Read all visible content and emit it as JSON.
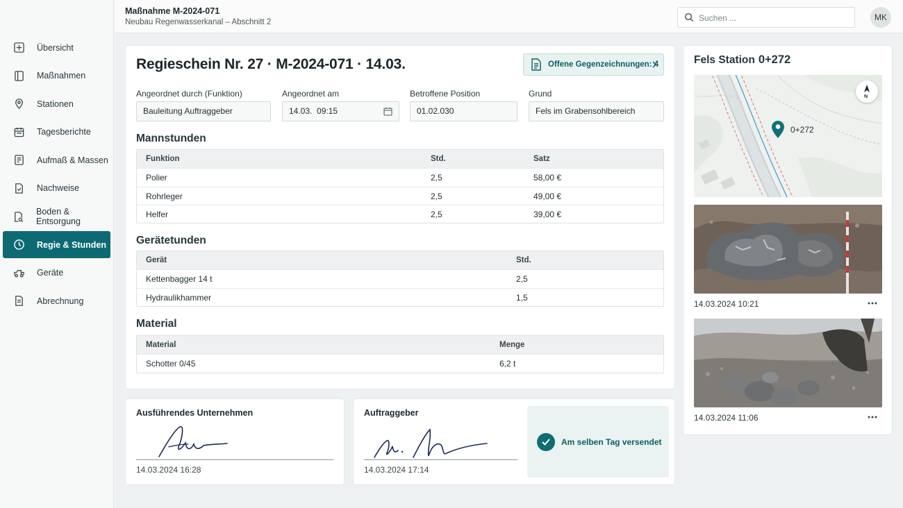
{
  "header": {
    "title": "Maßnahme M-2024-071",
    "subtitle": "Neubau Regenwasserkanal – Abschnitt 2",
    "search_placeholder": "Suchen ...",
    "avatar_initials": "MK"
  },
  "sidebar": {
    "items": [
      {
        "label": "Übersicht",
        "icon": "overview-icon"
      },
      {
        "label": "Maßnahmen",
        "icon": "measures-icon"
      },
      {
        "label": "Stationen",
        "icon": "location-pin-icon"
      },
      {
        "label": "Tagesberichte",
        "icon": "calendar-icon"
      },
      {
        "label": "Aufmaß & Massen",
        "icon": "checklist-icon"
      },
      {
        "label": "Nachweise",
        "icon": "document-check-icon"
      },
      {
        "label": "Boden & Entsorgung",
        "icon": "soil-search-icon"
      },
      {
        "label": "Regie & Stunden",
        "icon": "clock-icon",
        "active": true
      },
      {
        "label": "Geräte",
        "icon": "vehicle-icon"
      },
      {
        "label": "Abrechnung",
        "icon": "invoice-icon"
      }
    ]
  },
  "document": {
    "title": "Regieschein Nr. 27 · M-2024-071 · 14.03.",
    "pending_label": "Offene Gegenzeichnungen: 4",
    "fields": {
      "ordered_by_label": "Angeordnet durch (Funktion)",
      "ordered_by_value": "Bauleitung Auftraggeber",
      "ordered_at_label": "Angeordnet am",
      "ordered_at_value": "14.03.  09:15",
      "position_label": "Betroffene Position",
      "position_value": "01.02.030",
      "reason_label": "Grund",
      "reason_value": "Fels im Grabensohlbereich"
    },
    "labor": {
      "title": "Mannstunden",
      "headers": [
        "Funktion",
        "Std.",
        "Satz"
      ],
      "rows": [
        [
          "Polier",
          "2,5",
          "58,00 €"
        ],
        [
          "Rohrleger",
          "2,5",
          "49,00 €"
        ],
        [
          "Helfer",
          "2,5",
          "39,00 €"
        ]
      ]
    },
    "equipment": {
      "title": "Gerätetunden",
      "headers": [
        "Gerät",
        "Std."
      ],
      "rows": [
        [
          "Kettenbagger 14 t",
          "2,5"
        ],
        [
          "Hydraulikhammer",
          "1,5"
        ]
      ]
    },
    "material": {
      "title": "Material",
      "headers": [
        "Material",
        "Menge"
      ],
      "rows": [
        [
          "Schotter 0/45",
          "6,2 t"
        ]
      ]
    }
  },
  "side": {
    "title": "Fels Station",
    "station": "0+272",
    "map_marker_label": "0+272",
    "compass_label": "N",
    "photos": [
      {
        "date": "14.03.2024 10:21"
      },
      {
        "date": "14.03.2024 11:06"
      }
    ]
  },
  "signatures": {
    "contractor": {
      "title": "Ausführendes Unternehmen",
      "date": "14.03.2024 16:28"
    },
    "client": {
      "title": "Auftraggeber",
      "date": "14.03.2024 17:14"
    },
    "sent_label": "Am selben Tag versendet"
  },
  "colors": {
    "accent": "#0d6a72",
    "accent_light": "#e8f3f1"
  }
}
